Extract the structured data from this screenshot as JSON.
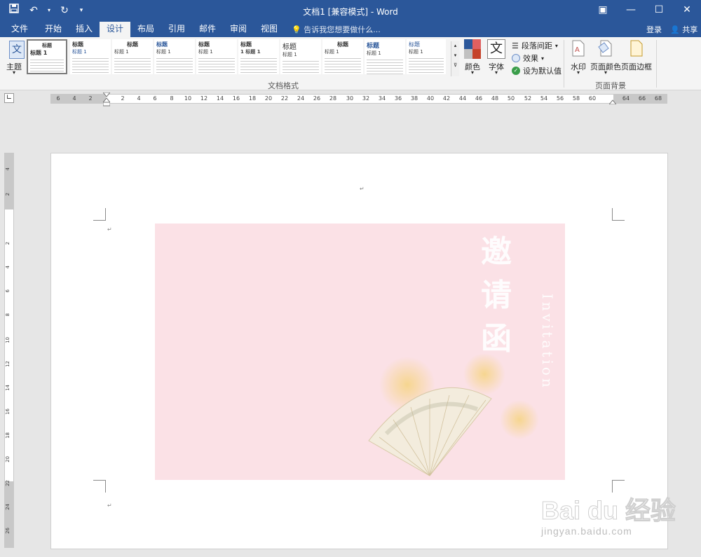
{
  "titlebar": {
    "doc_title": "文档1 [兼容模式] - Word"
  },
  "tabs": [
    {
      "label": "文件",
      "active": false
    },
    {
      "label": "开始",
      "active": false
    },
    {
      "label": "插入",
      "active": false
    },
    {
      "label": "设计",
      "active": true
    },
    {
      "label": "布局",
      "active": false
    },
    {
      "label": "引用",
      "active": false
    },
    {
      "label": "邮件",
      "active": false
    },
    {
      "label": "审阅",
      "active": false
    },
    {
      "label": "视图",
      "active": false
    }
  ],
  "tellme": "告诉我您想要做什么...",
  "login": "登录",
  "share": "共享",
  "ribbon": {
    "theme_label": "主题",
    "gallery": [
      {
        "title": "标题 1",
        "heading": "标题"
      },
      {
        "title": "标题",
        "heading": "标题 1"
      },
      {
        "title": "标题",
        "heading": "标题 1"
      },
      {
        "title": "标题",
        "heading": "标题 1"
      },
      {
        "title": "标题",
        "heading": "标题 1"
      },
      {
        "title": "标题",
        "heading": "1 标题 1"
      },
      {
        "title": "标题",
        "heading": "标题 1"
      },
      {
        "title": "标题",
        "heading": "标题 1"
      },
      {
        "title": "标题",
        "heading": "标题 1"
      },
      {
        "title": "标题",
        "heading": "标题 1"
      }
    ],
    "group_doc_format": "文档格式",
    "colors_label": "颜色",
    "fonts_label": "字体",
    "para_spacing": "段落间距",
    "effects": "效果",
    "set_default": "设为默认值",
    "watermark": "水印",
    "page_color": "页面颜色",
    "page_border": "页面边框",
    "group_page_bg": "页面背景"
  },
  "ruler": {
    "h_numbers": [
      "6",
      "4",
      "2",
      "2",
      "4",
      "6",
      "8",
      "10",
      "12",
      "14",
      "16",
      "18",
      "20",
      "22",
      "24",
      "26",
      "28",
      "30",
      "32",
      "34",
      "36",
      "38",
      "40",
      "42",
      "44",
      "46",
      "48",
      "50",
      "52",
      "54",
      "56",
      "58",
      "60",
      "64",
      "66",
      "68"
    ],
    "v_numbers": [
      "4",
      "2",
      "2",
      "4",
      "6",
      "8",
      "10",
      "12",
      "14",
      "16",
      "18",
      "20",
      "22",
      "24",
      "26"
    ]
  },
  "invitation": {
    "calligraphy": "邀请函",
    "english": "Invitation"
  },
  "watermark": {
    "brand": "Bai du 经验",
    "url": "jingyan.baidu.com"
  },
  "colors": {
    "title_bar": "#2b579a",
    "invite_bg": "#fbe1e6"
  }
}
